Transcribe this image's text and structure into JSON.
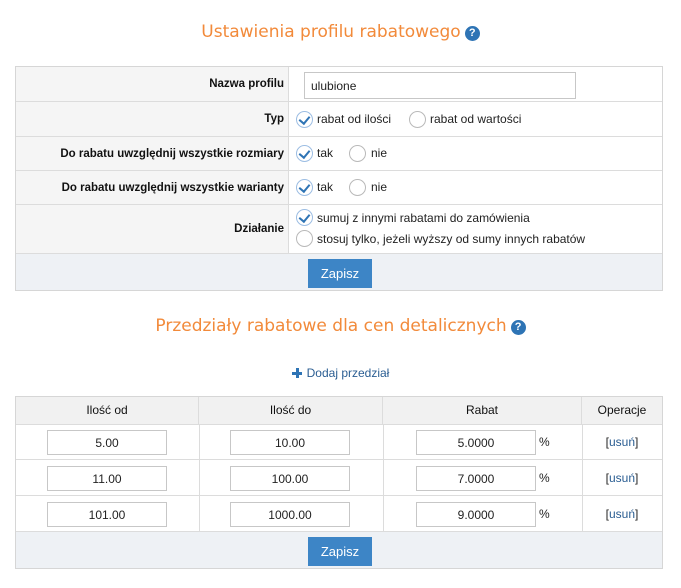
{
  "settings": {
    "title": "Ustawienia profilu rabatowego",
    "help": "?",
    "profile_name_label": "Nazwa profilu",
    "profile_name_value": "ulubione",
    "type_label": "Typ",
    "type_options": [
      {
        "label": "rabat od ilości",
        "checked": true
      },
      {
        "label": "rabat od wartości",
        "checked": false
      }
    ],
    "sizes_label": "Do rabatu uwzględnij wszystkie rozmiary",
    "sizes_options": [
      {
        "label": "tak",
        "checked": true
      },
      {
        "label": "nie",
        "checked": false
      }
    ],
    "variants_label": "Do rabatu uwzględnij wszystkie warianty",
    "variants_options": [
      {
        "label": "tak",
        "checked": true
      },
      {
        "label": "nie",
        "checked": false
      }
    ],
    "action_label": "Działanie",
    "action_options": [
      {
        "label": "sumuj z innymi rabatami do zamówienia",
        "checked": true
      },
      {
        "label": "stosuj tylko, jeżeli wyższy od sumy innych rabatów",
        "checked": false
      }
    ],
    "save_label": "Zapisz"
  },
  "ranges": {
    "title": "Przedziały rabatowe dla cen detalicznych",
    "help": "?",
    "add_label": "Dodaj przedział",
    "columns": [
      "Ilość od",
      "Ilość do",
      "Rabat",
      "Operacje"
    ],
    "rows": [
      {
        "from": "5.00",
        "to": "10.00",
        "discount": "5.0000",
        "unit": "%",
        "op_open": "[",
        "op_label": "usuń",
        "op_close": "]"
      },
      {
        "from": "11.00",
        "to": "100.00",
        "discount": "7.0000",
        "unit": "%",
        "op_open": "[",
        "op_label": "usuń",
        "op_close": "]"
      },
      {
        "from": "101.00",
        "to": "1000.00",
        "discount": "9.0000",
        "unit": "%",
        "op_open": "[",
        "op_label": "usuń",
        "op_close": "]"
      }
    ],
    "save_label": "Zapisz"
  },
  "colors": {
    "accent_orange": "#f28a3a",
    "primary_blue": "#3d85c6"
  }
}
